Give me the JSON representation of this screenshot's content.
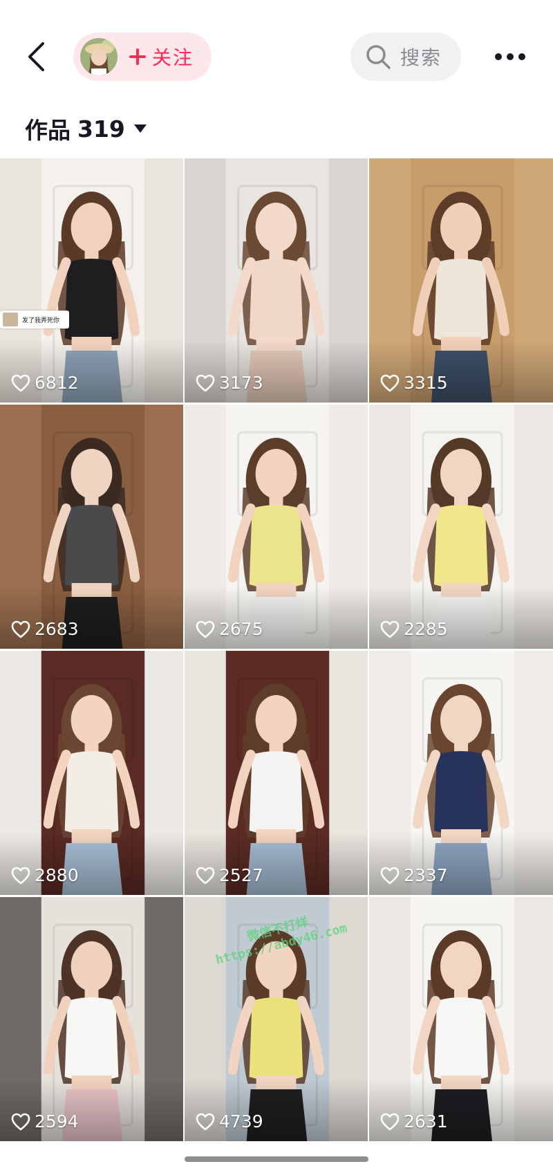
{
  "header": {
    "follow_label": "关注",
    "search_label": "搜索"
  },
  "works": {
    "label": "作品",
    "count": "319"
  },
  "icons": {
    "back": "chevron-left-icon",
    "plus": "plus-icon",
    "search": "search-icon",
    "more": "more-horizontal-icon",
    "caret": "caret-down-icon",
    "heart": "heart-outline-icon"
  },
  "colors": {
    "accent": "#fe2c55",
    "follow_bg": "#fde7ea",
    "search_bg": "#f1f1f2",
    "text": "#161823"
  },
  "videos": [
    {
      "likes": "6812",
      "palette": {
        "bg": "#e9e4dc",
        "door": "#f4f1ec",
        "top": "#1e1e20",
        "bottom": "#8ea3b8",
        "hair": "#5a3a28",
        "skin": "#f1d2bf"
      },
      "overlay_text": "发了我弄死你"
    },
    {
      "likes": "3173",
      "palette": {
        "bg": "#d9d4cf",
        "door": "#e8e4df",
        "top": "#efd8c8",
        "bottom": "#e3c9b8",
        "hair": "#6b4a34",
        "skin": "#f3d9c9"
      }
    },
    {
      "likes": "3315",
      "palette": {
        "bg": "#cfa877",
        "door": "#c79d6c",
        "top": "#efe6da",
        "bottom": "#3f5068",
        "hair": "#5d3d28",
        "skin": "#f0cfb8"
      }
    },
    {
      "likes": "2683",
      "palette": {
        "bg": "#9b6f4f",
        "door": "#8a5e40",
        "top": "#4a4a4d",
        "bottom": "#1e1e1e",
        "hair": "#3a2a22",
        "skin": "#f0d4c2"
      }
    },
    {
      "likes": "2675",
      "palette": {
        "bg": "#eeebe6",
        "door": "#f6f4f0",
        "top": "#ece48c",
        "bottom": "#f3f3f1",
        "hair": "#5b3d2a",
        "skin": "#f1d3c0"
      }
    },
    {
      "likes": "2285",
      "palette": {
        "bg": "#ebe8e3",
        "door": "#f5f3ef",
        "top": "#f0e68c",
        "bottom": "#f4f4f2",
        "hair": "#553a28",
        "skin": "#f2d5c3"
      }
    },
    {
      "likes": "2880",
      "palette": {
        "bg": "#ece9e4",
        "door": "#5a2a24",
        "top": "#f2eee6",
        "bottom": "#a9c0d6",
        "hair": "#6b4632",
        "skin": "#f2d4c0"
      }
    },
    {
      "likes": "2527",
      "palette": {
        "bg": "#e9e6e0",
        "door": "#5b2b24",
        "top": "#f4f3f1",
        "bottom": "#a6bdd3",
        "hair": "#5e3e2b",
        "skin": "#f1d3bf"
      }
    },
    {
      "likes": "2337",
      "palette": {
        "bg": "#efece8",
        "door": "#f7f5f2",
        "top": "#27335a",
        "bottom": "#8ea6c2",
        "hair": "#6a4530",
        "skin": "#f2d6c4"
      }
    },
    {
      "likes": "2594",
      "palette": {
        "bg": "#6f6a66",
        "door": "#e6e1db",
        "top": "#f6f6f4",
        "bottom": "#e8c4c8",
        "hair": "#4d3426",
        "skin": "#f0d1bd"
      }
    },
    {
      "likes": "4739",
      "palette": {
        "bg": "#dcd8d2",
        "door": "#bfcad3",
        "top": "#e9e27a",
        "bottom": "#1f1f1f",
        "hair": "#5a3c29",
        "skin": "#f1d4c1"
      },
      "watermark_lines": [
        "微信不打烊",
        "https://abdy46.com"
      ]
    },
    {
      "likes": "2631",
      "palette": {
        "bg": "#ece9e4",
        "door": "#f6f4f0",
        "top": "#f7f7f5",
        "bottom": "#1e1e22",
        "hair": "#5a3b29",
        "skin": "#f2d5c3"
      }
    }
  ]
}
